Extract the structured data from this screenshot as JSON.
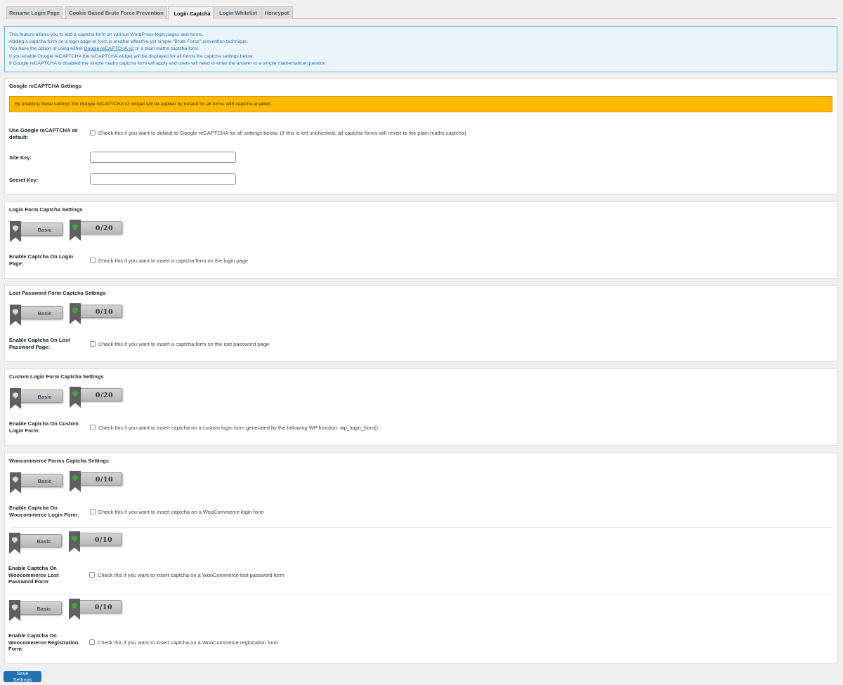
{
  "tabs": [
    {
      "label": "Rename Login Page"
    },
    {
      "label": "Cookie Based Brute Force Prevention"
    },
    {
      "label": "Login Captcha"
    },
    {
      "label": "Login Whitelist"
    },
    {
      "label": "Honeypot"
    }
  ],
  "info": {
    "line1": "This feature allows you to add a captcha form on various WordPress login pages and forms.",
    "line2": "Adding a captcha form on a login page or form is another effective yet simple \"Brute Force\" prevention technique.",
    "line3_pre": "You have the option of using either ",
    "line3_link": "Google reCAPTCHA v2",
    "line3_post": " or a plain maths captcha form.",
    "line4": "If you enable Google reCAPTCHA the reCAPTCHA widget will be displayed for all forms the captcha settings below.",
    "line5": "If Google reCAPTCHA is disabled the simple maths captcha form will apply and users will need to enter the answer to a simple mathematical question."
  },
  "recaptcha": {
    "title": "Google reCAPTCHA Settings",
    "notice": "By enabling these settings the Google reCAPTCHA v2 widget will be applied by default for all forms with captcha enabled.",
    "default_label": "Use Google reCAPTCHA as default:",
    "default_text": "Check this if you want to default to Google reCAPTCHA for all settings below. (If this is left unchecked, all captcha forms will revert to the plain maths captcha)",
    "site_key_label": "Site Key:",
    "site_key_value": "",
    "secret_key_label": "Secret Key:",
    "secret_key_value": ""
  },
  "badges": {
    "basic": "Basic",
    "login_score": "0/20",
    "lost_password_score": "0/10",
    "custom_login_score": "0/20",
    "woo_login_score": "0/10",
    "woo_lost_password_score": "0/10",
    "woo_registration_score": "0/10"
  },
  "login_form": {
    "title": "Login Form Captcha Settings",
    "label": "Enable Captcha On Login Page:",
    "text": "Check this if you want to insert a captcha form on the login page"
  },
  "lost_password": {
    "title": "Lost Password Form Captcha Settings",
    "label": "Enable Captcha On Lost Password Page:",
    "text": "Check this if you want to insert a captcha form on the lost password page"
  },
  "custom_login": {
    "title": "Custom Login Form Captcha Settings",
    "label": "Enable Captcha On Custom Login Form:",
    "text": "Check this if you want to insert captcha on a custom login form generated by the following WP function: wp_login_form()"
  },
  "woocommerce": {
    "title": "Woocommerce Forms Captcha Settings",
    "login_label": "Enable Captcha On Woocommerce Login Form:",
    "login_text": "Check this if you want to insert captcha on a WooCommerce login form",
    "lost_label": "Enable Captcha On Woocommerce Lost Password Form:",
    "lost_text": "Check this if you want to insert captcha on a WooCommerce lost password form",
    "reg_label": "Enable Captcha On Woocommerce Registration Form:",
    "reg_text": "Check this if you want to insert captcha on a WooCommerce registration form"
  },
  "save_label": "Save Settings",
  "colors": {
    "primary": "#2271b1",
    "notice": "#ffb900",
    "info_bg": "#eaf4fb",
    "shield_green": "#3ea83e"
  }
}
